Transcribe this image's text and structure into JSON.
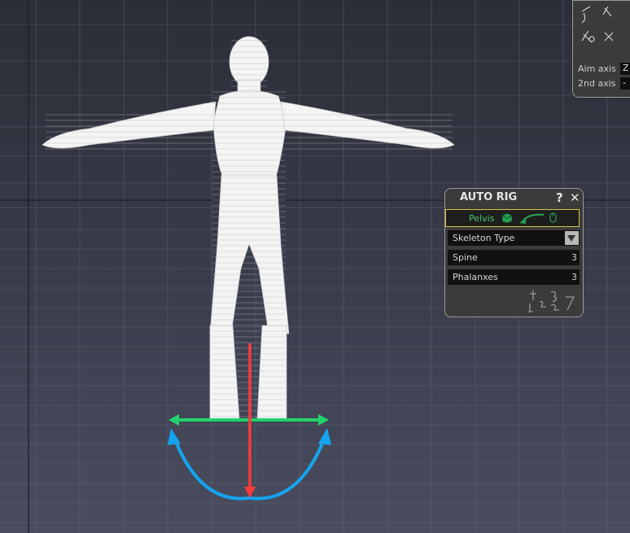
{
  "viewport": {
    "grid_color": "#767a8a",
    "manipulator": {
      "x_axis_color": "#ff3b3b",
      "y_axis_color": "#22d36b",
      "rotate_color": "#15a4ef"
    }
  },
  "autorig": {
    "title": "AUTO RIG",
    "help_label": "?",
    "close_label": "✕",
    "picker_label": "Pelvis",
    "skeleton_type_label": "Skeleton Type",
    "spine_label": "Spine",
    "spine_value": "3",
    "phalanxes_label": "Phalanxes",
    "phalanxes_value": "3"
  },
  "aim": {
    "aim_axis_label": "Aim axis",
    "aim_axis_value": "Z",
    "second_axis_label": "2nd axis",
    "second_axis_value": "-"
  }
}
